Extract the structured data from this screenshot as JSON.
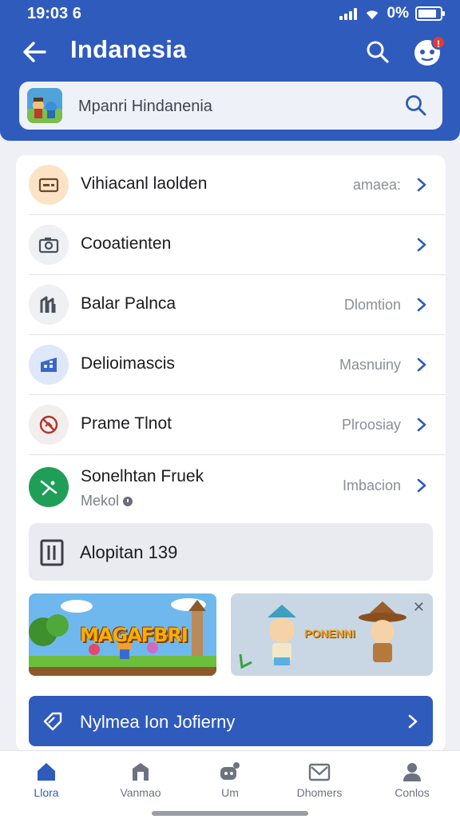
{
  "status_bar": {
    "time": "19:03 6",
    "battery": "0%"
  },
  "header": {
    "title": "Indanesia",
    "notification_badge": "!"
  },
  "search": {
    "text": "Mpanri Hindanenia"
  },
  "list": [
    {
      "label": "Vihiacanl laolden",
      "value": "amaea:",
      "icon": "wallet-icon",
      "icon_bg": "#fde3c6",
      "icon_color": "#6b4a2a"
    },
    {
      "label": "Cooatienten",
      "value": "",
      "icon": "camera-icon",
      "icon_bg": "#eef0f3",
      "icon_color": "#4a4f5a"
    },
    {
      "label": "Balar Palnca",
      "value": "Dlomtion",
      "icon": "chart-icon",
      "icon_bg": "#eef0f3",
      "icon_color": "#4a4f5a"
    },
    {
      "label": "Delioimascis",
      "value": "Masnuiny",
      "icon": "building-icon",
      "icon_bg": "#dfe8fa",
      "icon_color": "#3a66c8"
    },
    {
      "label": "Prame Tlnot",
      "value": "Plroosiay",
      "icon": "no-entry-icon",
      "icon_bg": "#f3eeee",
      "icon_color": "#b3342a"
    },
    {
      "label": "Sonelhtan Fruek",
      "sub": "Mekol",
      "value": "Imbacion",
      "icon": "plane-icon",
      "icon_bg": "#1f9e57",
      "icon_color": "#ffffff"
    }
  ],
  "promo": {
    "label": "Alopitan 139"
  },
  "banners": [
    {
      "title": "MAGAFBRI"
    },
    {
      "title": "PONENNI",
      "close": "✕"
    }
  ],
  "cta": {
    "label": "Nylmea Ion Jofierny"
  },
  "bottom_nav": [
    {
      "label": "Llora",
      "icon": "home-icon",
      "active": true
    },
    {
      "label": "Vanmao",
      "icon": "bag-icon",
      "active": false
    },
    {
      "label": "Um",
      "icon": "gamepad-icon",
      "active": false
    },
    {
      "label": "Dhomers",
      "icon": "mail-icon",
      "active": false
    },
    {
      "label": "Conlos",
      "icon": "person-icon",
      "active": false
    }
  ],
  "colors": {
    "primary": "#2f5bbd",
    "background": "#eef0f5",
    "danger": "#e53935",
    "success": "#1f9e57"
  }
}
